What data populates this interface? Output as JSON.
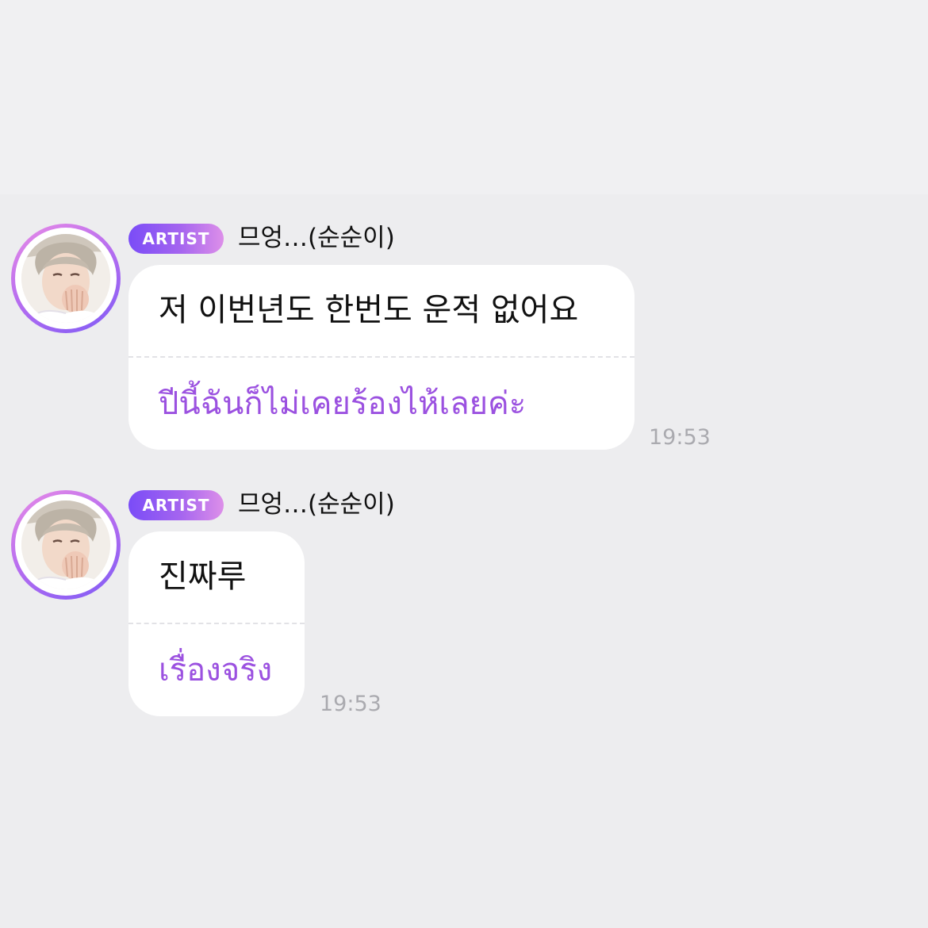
{
  "colors": {
    "background": "#ededef",
    "bubble": "#ffffff",
    "translation_text": "#9b51e0",
    "timestamp": "#aaaaaf",
    "badge_gradient_start": "#7a4cf7",
    "badge_gradient_end": "#dd8fe9"
  },
  "messages": [
    {
      "badge": "ARTIST",
      "sender": "므엉…(순순이)",
      "original_text": "저 이번년도 한번도 운적 없어요",
      "translated_text": "ปีนี้ฉันก็ไม่เคยร้องไห้เลยค่ะ",
      "time": "19:53",
      "avatar_icon": "artist-profile-photo"
    },
    {
      "badge": "ARTIST",
      "sender": "므엉…(순순이)",
      "original_text": "진짜루",
      "translated_text": "เรื่องจริง",
      "time": "19:53",
      "avatar_icon": "artist-profile-photo"
    }
  ]
}
